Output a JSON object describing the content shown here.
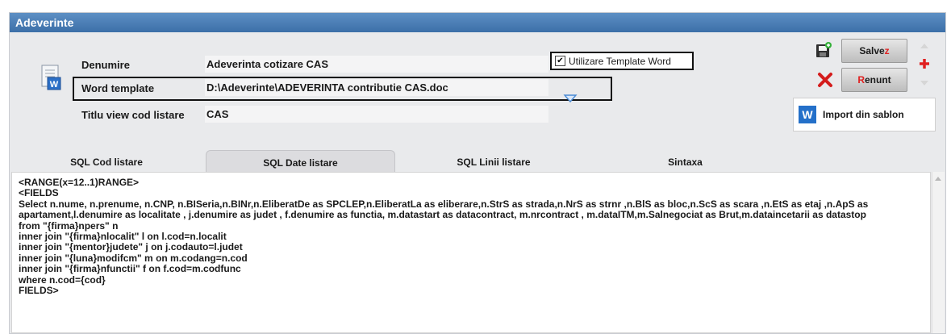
{
  "window": {
    "title": "Adeverinte"
  },
  "form": {
    "denumire_label": "Denumire",
    "denumire_value": "Adeverinta cotizare  CAS",
    "word_template_label": "Word template",
    "word_template_value": "D:\\Adeverinte\\ADEVERINTA contributie CAS.doc",
    "titlu_label": "Titlu view cod listare",
    "titlu_value": "CAS",
    "use_template_label": "Utilizare Template Word",
    "use_template_checked": "✔"
  },
  "buttons": {
    "save_prefix": "Salve",
    "save_hot": "z",
    "cancel_hot": "R",
    "cancel_suffix": "enunt",
    "import_label": "Import din sablon",
    "import_icon_letter": "W"
  },
  "tabs": [
    {
      "label": "SQL Cod listare",
      "active": false
    },
    {
      "label": "SQL Date listare",
      "active": true
    },
    {
      "label": "SQL Linii listare",
      "active": false
    },
    {
      "label": "Sintaxa",
      "active": false
    }
  ],
  "sql_lines": [
    "<RANGE(x=12..1)RANGE>",
    "<FIELDS",
    "Select n.nume, n.prenume, n.CNP, n.BISeria,n.BINr,n.EliberatDe as SPCLEP,n.EliberatLa as eliberare,n.StrS as strada,n.NrS as strnr ,n.BlS as bloc,n.ScS as scara ,n.EtS as etaj ,n.ApS as apartament,l.denumire as localitate , j.denumire as judet , f.denumire as functia, m.datastart as datacontract, m.nrcontract , m.dataITM,m.Salnegociat as Brut,m.dataincetarii as datastop",
    "from \"{firma}npers\" n",
    "inner join \"{firma}nlocalit\" l on l.cod=n.localit",
    "inner join \"{mentor}judete\" j on j.codauto=l.judet",
    "inner join \"{luna}modifcm\" m on m.codang=n.cod",
    "inner join \"{firma}nfunctii\" f on f.cod=m.codfunc",
    "where n.cod={cod}",
    "FIELDS>"
  ],
  "colors": {
    "titlebar": "#4a7db6",
    "accent_red": "#e02020",
    "word_blue": "#2470c9"
  }
}
